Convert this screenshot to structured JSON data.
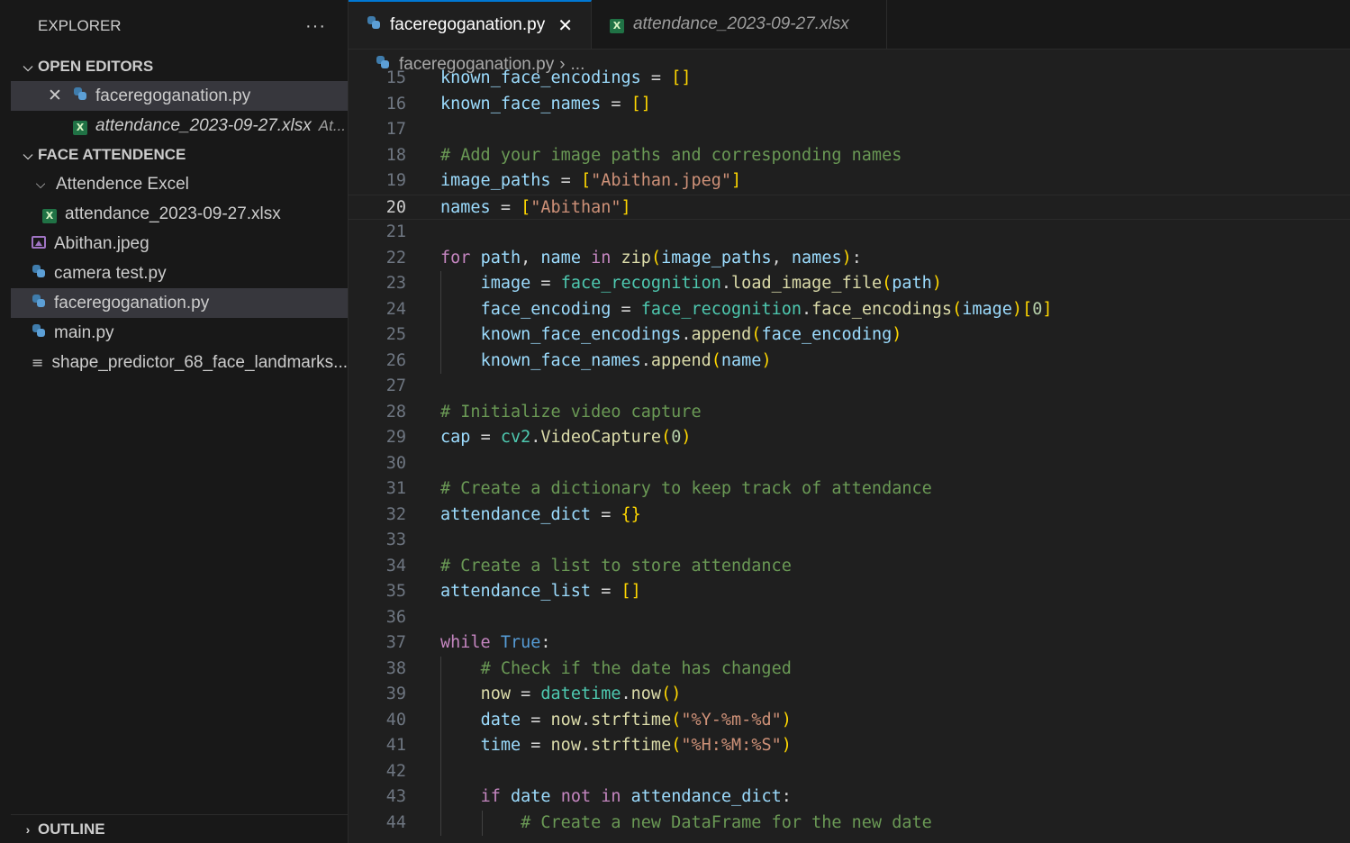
{
  "sidebar": {
    "title": "EXPLORER",
    "more": "···",
    "open_editors": {
      "label": "OPEN EDITORS",
      "items": [
        {
          "name": "faceregoganation.py"
        },
        {
          "name": "attendance_2023-09-27.xlsx",
          "hint": "At..."
        }
      ]
    },
    "folder": {
      "label": "FACE ATTENDENCE",
      "subfolder": "Attendence Excel",
      "files": [
        "attendance_2023-09-27.xlsx",
        "Abithan.jpeg",
        "camera test.py",
        "faceregoganation.py",
        "main.py",
        "shape_predictor_68_face_landmarks..."
      ]
    },
    "outline": "OUTLINE"
  },
  "tabs": [
    {
      "label": "faceregoganation.py",
      "active": true
    },
    {
      "label": "attendance_2023-09-27.xlsx",
      "active": false
    }
  ],
  "breadcrumb": {
    "file": "faceregoganation.py",
    "rest": "..."
  },
  "code": [
    {
      "n": 15,
      "text": "known_face_encodings = []"
    },
    {
      "n": 16,
      "text": "known_face_names = []"
    },
    {
      "n": 17,
      "text": ""
    },
    {
      "n": 18,
      "text": "# Add your image paths and corresponding names"
    },
    {
      "n": 19,
      "text": "image_paths = [\"Abithan.jpeg\"]"
    },
    {
      "n": 20,
      "text": "names = [\"Abithan\"]"
    },
    {
      "n": 21,
      "text": ""
    },
    {
      "n": 22,
      "text": "for path, name in zip(image_paths, names):"
    },
    {
      "n": 23,
      "text": "    image = face_recognition.load_image_file(path)"
    },
    {
      "n": 24,
      "text": "    face_encoding = face_recognition.face_encodings(image)[0]"
    },
    {
      "n": 25,
      "text": "    known_face_encodings.append(face_encoding)"
    },
    {
      "n": 26,
      "text": "    known_face_names.append(name)"
    },
    {
      "n": 27,
      "text": ""
    },
    {
      "n": 28,
      "text": "# Initialize video capture"
    },
    {
      "n": 29,
      "text": "cap = cv2.VideoCapture(0)"
    },
    {
      "n": 30,
      "text": ""
    },
    {
      "n": 31,
      "text": "# Create a dictionary to keep track of attendance"
    },
    {
      "n": 32,
      "text": "attendance_dict = {}"
    },
    {
      "n": 33,
      "text": ""
    },
    {
      "n": 34,
      "text": "# Create a list to store attendance"
    },
    {
      "n": 35,
      "text": "attendance_list = []"
    },
    {
      "n": 36,
      "text": ""
    },
    {
      "n": 37,
      "text": "while True:"
    },
    {
      "n": 38,
      "text": "    # Check if the date has changed"
    },
    {
      "n": 39,
      "text": "    now = datetime.now()"
    },
    {
      "n": 40,
      "text": "    date = now.strftime(\"%Y-%m-%d\")"
    },
    {
      "n": 41,
      "text": "    time = now.strftime(\"%H:%M:%S\")"
    },
    {
      "n": 42,
      "text": ""
    },
    {
      "n": 43,
      "text": "    if date not in attendance_dict:"
    },
    {
      "n": 44,
      "text": "        # Create a new DataFrame for the new date"
    }
  ],
  "current_line": 20
}
